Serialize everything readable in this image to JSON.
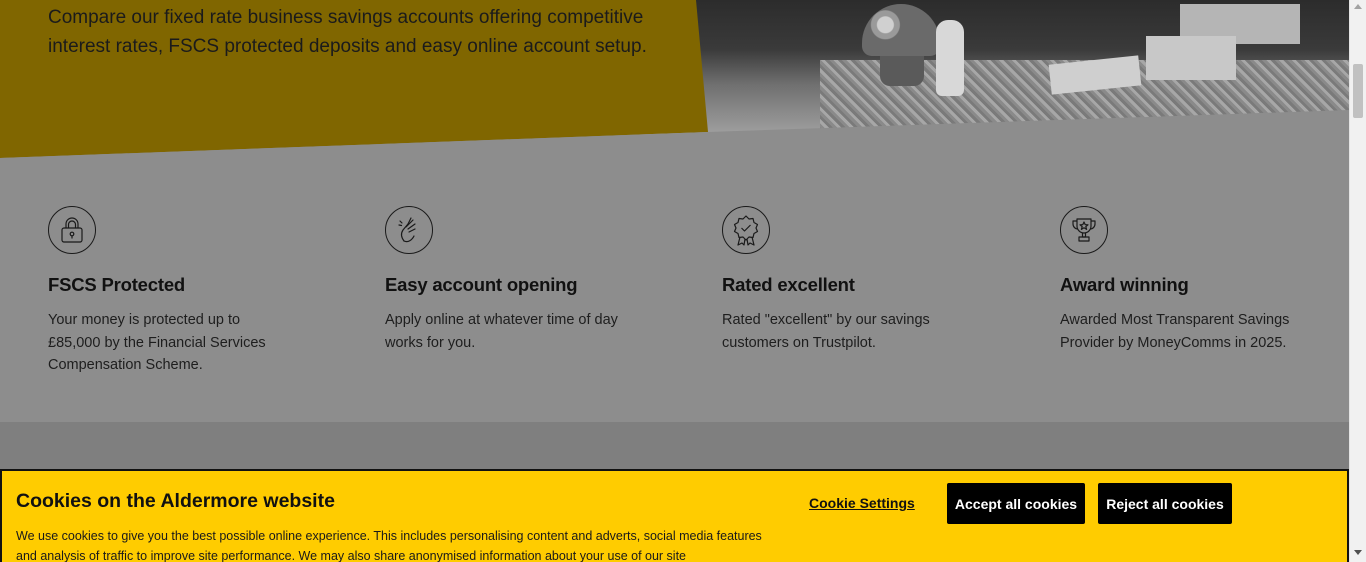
{
  "hero": {
    "description": "Compare our fixed rate business savings accounts offering competitive interest rates, FSCS protected deposits and easy online account setup."
  },
  "features": [
    {
      "icon": "padlock-icon",
      "title": "FSCS Protected",
      "text": "Your money is protected up to £85,000 by the Financial Services Compensation Scheme."
    },
    {
      "icon": "hand-gesture-icon",
      "title": "Easy account opening",
      "text": "Apply online at whatever time of day works for you."
    },
    {
      "icon": "rosette-icon",
      "title": "Rated excellent",
      "text": "Rated \"excellent\" by our savings customers on Trustpilot."
    },
    {
      "icon": "trophy-icon",
      "title": "Award winning",
      "text": "Awarded Most Transparent Savings Provider by MoneyComms in 2025."
    }
  ],
  "cookie_banner": {
    "title": "Cookies on the Aldermore website",
    "text": "We use cookies to give you the best possible online experience. This includes personalising content and adverts, social media features and analysis of traffic to improve site performance. We may also share anonymised information about your use of our site",
    "settings_label": "Cookie Settings",
    "accept_label": "Accept all cookies",
    "reject_label": "Reject all cookies"
  },
  "colors": {
    "brand_yellow": "#ffcc00",
    "overlay_yellow": "#806600",
    "overlay_grey": "#8d8d8d",
    "button_black": "#000000"
  }
}
